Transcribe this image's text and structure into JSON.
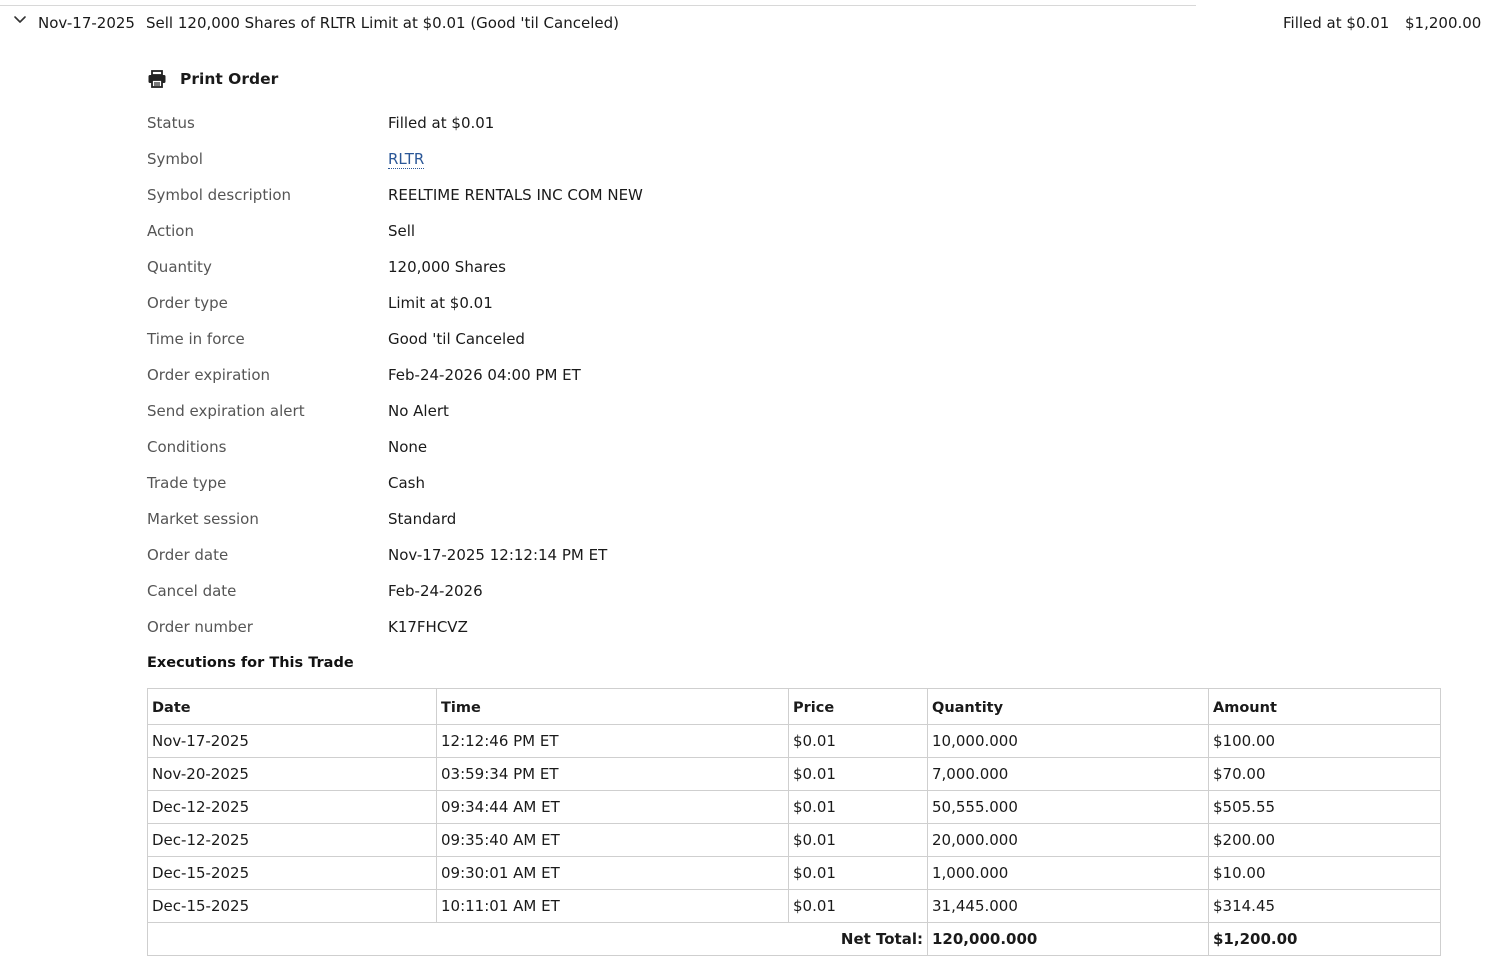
{
  "order": {
    "date": "Nov-17-2025",
    "description": "Sell 120,000 Shares of RLTR Limit at $0.01 (Good 'til Canceled)",
    "status": "Filled at $0.01",
    "amount": "$1,200.00"
  },
  "print_label": "Print Order",
  "details": [
    {
      "label": "Status",
      "value": "Filled at $0.01"
    },
    {
      "label": "Symbol",
      "value": "RLTR"
    },
    {
      "label": "Symbol description",
      "value": "REELTIME RENTALS INC COM NEW"
    },
    {
      "label": "Action",
      "value": "Sell"
    },
    {
      "label": "Quantity",
      "value": "120,000 Shares"
    },
    {
      "label": "Order type",
      "value": "Limit at $0.01"
    },
    {
      "label": "Time in force",
      "value": "Good 'til Canceled"
    },
    {
      "label": "Order expiration",
      "value": "Feb-24-2026 04:00 PM ET"
    },
    {
      "label": "Send expiration alert",
      "value": "No Alert"
    },
    {
      "label": "Conditions",
      "value": "None"
    },
    {
      "label": "Trade type",
      "value": "Cash"
    },
    {
      "label": "Market session",
      "value": "Standard"
    },
    {
      "label": "Order date",
      "value": "Nov-17-2025 12:12:14 PM ET"
    },
    {
      "label": "Cancel date",
      "value": "Feb-24-2026"
    },
    {
      "label": "Order number",
      "value": "K17FHCVZ"
    }
  ],
  "executions": {
    "title": "Executions for This Trade",
    "columns": [
      "Date",
      "Time",
      "Price",
      "Quantity",
      "Amount"
    ],
    "rows": [
      [
        "Nov-17-2025",
        "12:12:46 PM ET",
        "$0.01",
        "10,000.000",
        "$100.00"
      ],
      [
        "Nov-20-2025",
        "03:59:34 PM ET",
        "$0.01",
        "7,000.000",
        "$70.00"
      ],
      [
        "Dec-12-2025",
        "09:34:44 AM ET",
        "$0.01",
        "50,555.000",
        "$505.55"
      ],
      [
        "Dec-12-2025",
        "09:35:40 AM ET",
        "$0.01",
        "20,000.000",
        "$200.00"
      ],
      [
        "Dec-15-2025",
        "09:30:01 AM ET",
        "$0.01",
        "1,000.000",
        "$10.00"
      ],
      [
        "Dec-15-2025",
        "10:11:01 AM ET",
        "$0.01",
        "31,445.000",
        "$314.45"
      ]
    ],
    "total_label": "Net Total:",
    "total_quantity": "120,000.000",
    "total_amount": "$1,200.00"
  },
  "colors": {
    "link": "#2b5797",
    "label_text": "#555555",
    "border": "#cfcfcf"
  },
  "icons": {
    "toggle": "chevron-down-icon",
    "print": "printer-icon"
  }
}
